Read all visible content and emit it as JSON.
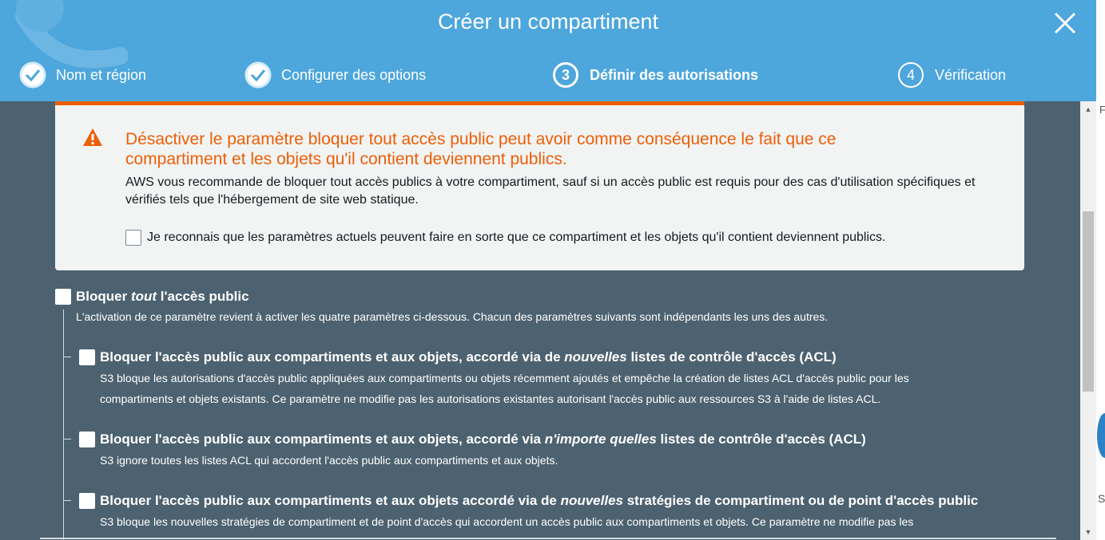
{
  "header": {
    "title": "Créer un compartiment",
    "background_color": "#4da6dc",
    "steps": [
      {
        "number": "1",
        "label": "Nom et région",
        "state": "done"
      },
      {
        "number": "2",
        "label": "Configurer des options",
        "state": "done"
      },
      {
        "number": "3",
        "label": "Définir des autorisations",
        "state": "active"
      },
      {
        "number": "4",
        "label": "Vérification",
        "state": "pending"
      }
    ]
  },
  "warning": {
    "accent_color": "#eb5f07",
    "title": "Désactiver le paramètre bloquer tout accès public peut avoir comme conséquence le fait que ce compartiment et les objets qu'il contient deviennent publics.",
    "text": "AWS vous recommande de bloquer tout accès publics à votre compartiment, sauf si un accès public est requis pour des cas d'utilisation spécifiques et vérifiés tels que l'hébergement de site web statique.",
    "acknowledge_label": "Je reconnais que les paramètres actuels peuvent faire en sorte que ce compartiment et les objets qu'il contient deviennent publics.",
    "acknowledge_checked": false
  },
  "block_all": {
    "title_pre": "Bloquer ",
    "title_em": "tout",
    "title_post": " l'accès public",
    "description": "L'activation de ce paramètre revient à activer les quatre paramètres ci-dessous. Chacun des paramètres suivants sont indépendants les uns des autres.",
    "checked": false
  },
  "settings": [
    {
      "title_pre": "Bloquer l'accès public aux compartiments et aux objets, accordé via de ",
      "title_em": "nouvelles",
      "title_post": " listes de contrôle d'accès (ACL)",
      "desc_line1": "S3 bloque les autorisations d'accès public appliquées aux compartiments ou objets récemment ajoutés et empêche la création de listes ACL d'accès public pour les",
      "desc_line2": "compartiments et objets existants. Ce paramètre ne modifie pas les autorisations existantes autorisant l'accès public aux ressources S3 à l'aide de listes ACL.",
      "checked": false
    },
    {
      "title_pre": "Bloquer l'accès public aux compartiments et aux objets, accordé via ",
      "title_em": "n'importe quelles",
      "title_post": " listes de contrôle d'accès (ACL)",
      "desc_line1": "S3 ignore toutes les listes ACL qui accordent l'accès public aux compartiments et aux objets.",
      "desc_line2": "",
      "checked": false
    },
    {
      "title_pre": "Bloquer l'accès public aux compartiments et aux objets accordé via de ",
      "title_em": "nouvelles",
      "title_post": " stratégies de compartiment ou de point d'accès public",
      "desc_line1": "S3 bloque les nouvelles stratégies de compartiment et de point d'accès qui accordent un accès public aux compartiments et objets. Ce paramètre ne modifie pas les",
      "desc_line2": "",
      "checked": false
    }
  ],
  "side": {
    "letter_top": "F",
    "letter_bottom": "S"
  },
  "icons": {
    "close": "close-icon",
    "done": "check-circle-icon",
    "warning": "warning-triangle-icon",
    "scroll_up": "arrow-up-icon",
    "scroll_down": "arrow-down-icon"
  }
}
